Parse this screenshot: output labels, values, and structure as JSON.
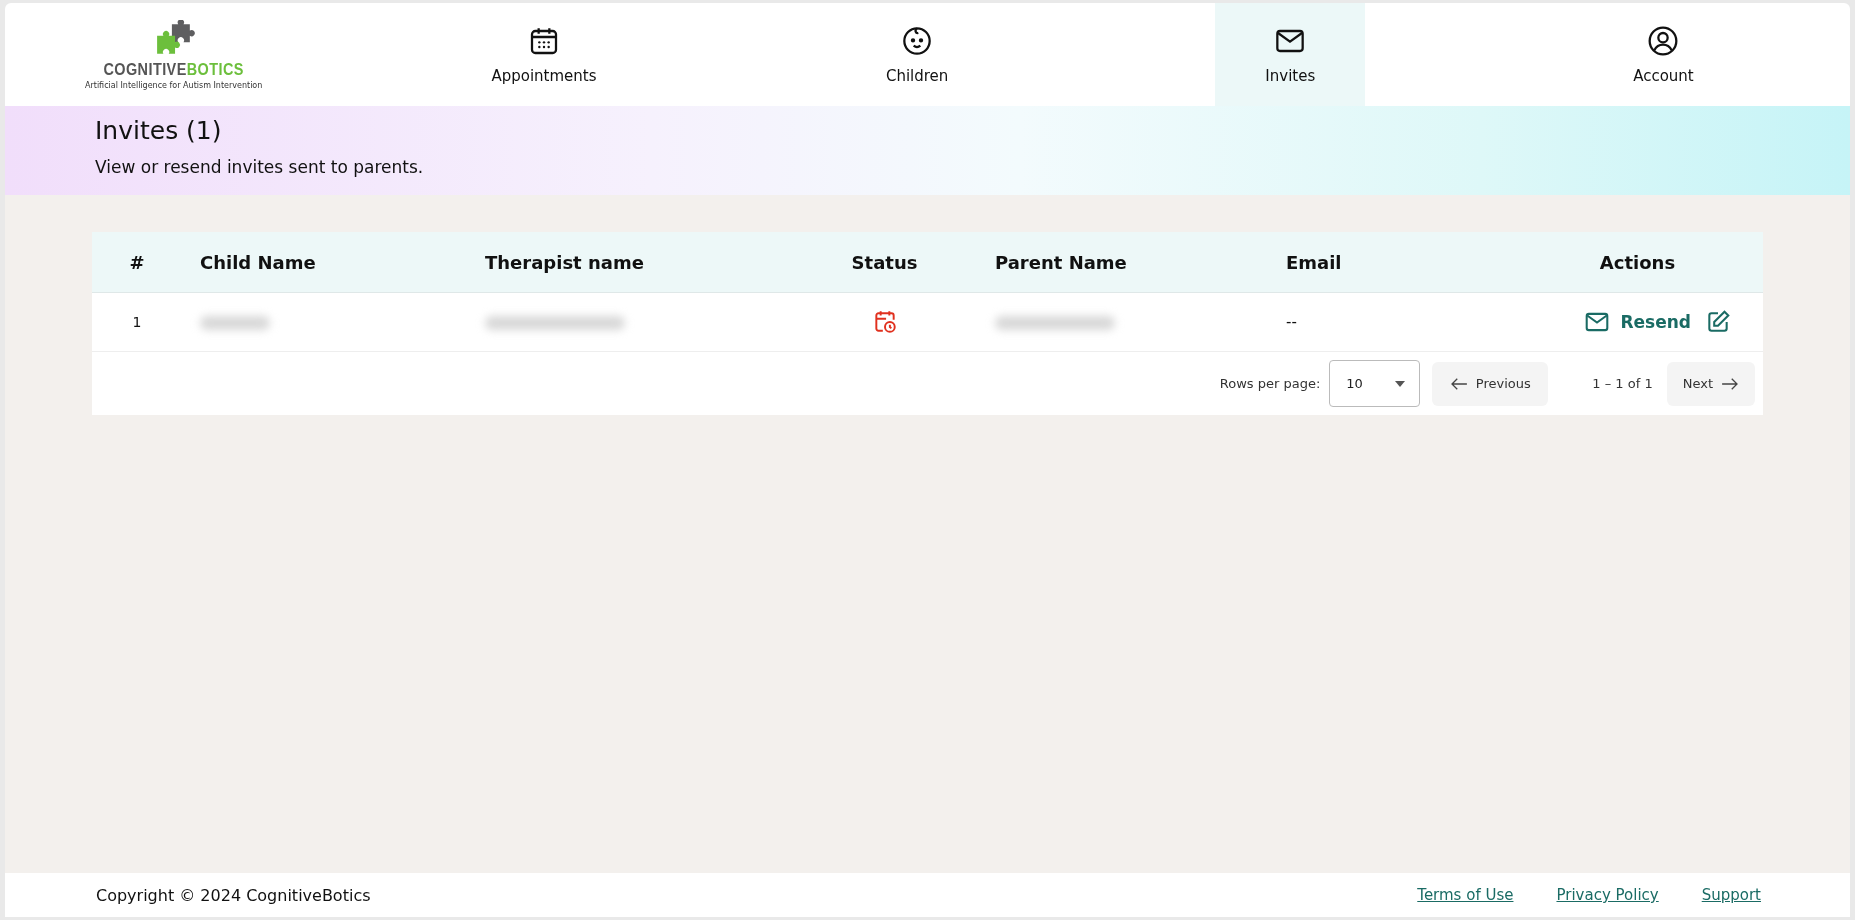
{
  "logo": {
    "word_1": "COGNITIVE",
    "word_2": "BOTICS",
    "tagline": "Artificial Intelligence for Autism Intervention"
  },
  "tabs": [
    {
      "label": "Appointments",
      "kind": "calendar",
      "selected": false
    },
    {
      "label": "Children",
      "kind": "baby",
      "selected": false
    },
    {
      "label": "Invites",
      "kind": "mail",
      "selected": true
    },
    {
      "label": "Account",
      "kind": "user",
      "selected": false
    }
  ],
  "banner": {
    "title": "Invites (1)",
    "subtitle": "View or resend invites sent to parents."
  },
  "table": {
    "columns": [
      "#",
      "Child Name",
      "Therapist name",
      "Status",
      "Parent Name",
      "Email",
      "Actions"
    ],
    "rows": [
      {
        "number": "1",
        "email": "--",
        "action": "Resend"
      }
    ]
  },
  "pagination": {
    "rows_per_page_label": "Rows per page:",
    "rows_per_page": "10",
    "previous": "Previous",
    "range": "1 – 1 of 1",
    "next": "Next"
  },
  "footer": {
    "copyright": "Copyright © 2024 CognitiveBotics",
    "links": [
      "Terms of Use",
      "Privacy Policy",
      "Support"
    ]
  }
}
